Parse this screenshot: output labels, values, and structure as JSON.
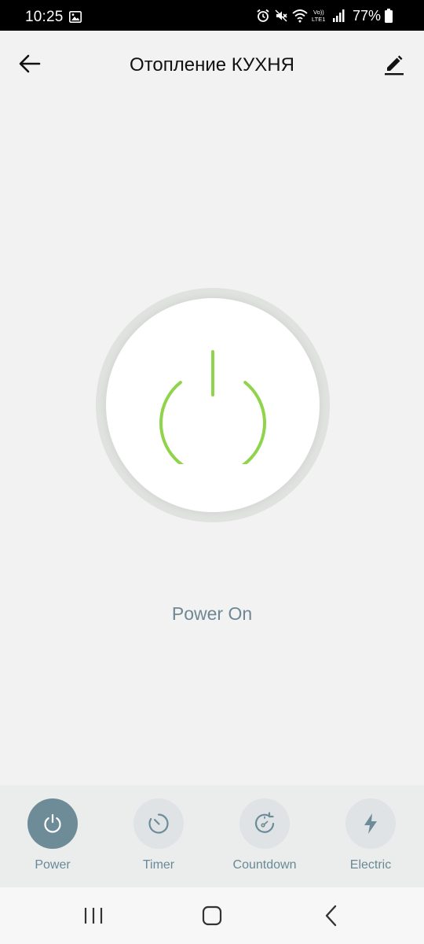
{
  "status_bar": {
    "time": "10:25",
    "battery_text": "77%",
    "network_label_top": "Vo))",
    "network_label_bottom": "LTE1"
  },
  "header": {
    "title": "Отопление КУХНЯ"
  },
  "power": {
    "status_text": "Power On",
    "is_on": true,
    "accent_color": "#8fd44a"
  },
  "functions": [
    {
      "label": "Power",
      "icon": "power-icon",
      "active": true
    },
    {
      "label": "Timer",
      "icon": "timer-icon",
      "active": false
    },
    {
      "label": "Countdown",
      "icon": "countdown-icon",
      "active": false
    },
    {
      "label": "Electric",
      "icon": "lightning-icon",
      "active": false
    }
  ],
  "colors": {
    "active_button": "#6d8c98",
    "inactive_button": "#dfe3e5",
    "label": "#6a8896",
    "status_text": "#6f8795"
  }
}
